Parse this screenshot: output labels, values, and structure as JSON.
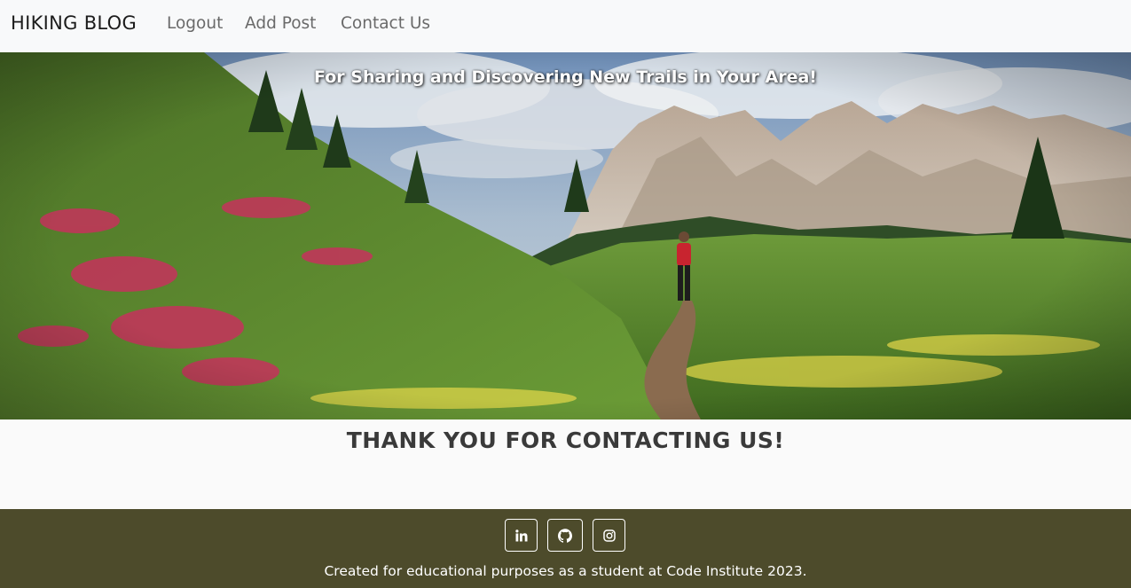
{
  "navbar": {
    "brand": "HIKING BLOG",
    "links": [
      {
        "label": "Logout"
      },
      {
        "label": "Add Post"
      },
      {
        "label": "Contact Us"
      }
    ]
  },
  "hero": {
    "tagline": "For Sharing and Discovering New Trails in Your Area!",
    "image": "alpine meadow with hiker on trail"
  },
  "main": {
    "heading": "THANK YOU FOR CONTACTING US!"
  },
  "footer": {
    "social": [
      {
        "icon": "linkedin-icon"
      },
      {
        "icon": "github-icon"
      },
      {
        "icon": "instagram-icon"
      }
    ],
    "copyright": "Created for educational purposes as a student at Code Institute 2023."
  },
  "colors": {
    "navbar_bg": "#f8f9fa",
    "footer_bg": "#4d4b2b",
    "page_bg": "#fafafa"
  }
}
